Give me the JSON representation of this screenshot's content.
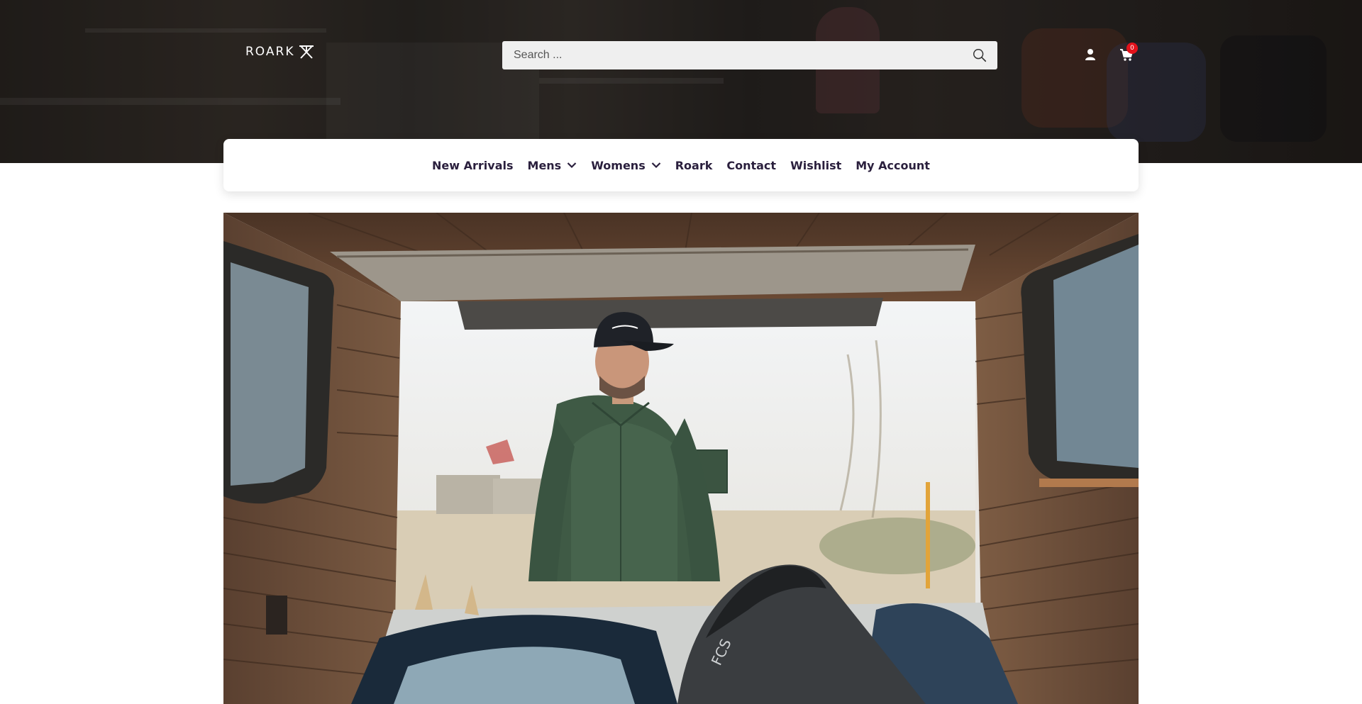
{
  "header": {
    "logo_text": "ROARK",
    "search": {
      "placeholder": "Search ...",
      "value": ""
    },
    "cart": {
      "count": "0"
    }
  },
  "nav": {
    "items": [
      {
        "label": "New Arrivals",
        "has_dropdown": false
      },
      {
        "label": "Mens",
        "has_dropdown": true
      },
      {
        "label": "Womens",
        "has_dropdown": true
      },
      {
        "label": "Roark",
        "has_dropdown": false
      },
      {
        "label": "Contact",
        "has_dropdown": false
      },
      {
        "label": "Wishlist",
        "has_dropdown": false
      },
      {
        "label": "My Account",
        "has_dropdown": false
      }
    ]
  },
  "icons": {
    "search": "search-icon",
    "user": "user-icon",
    "cart": "cart-icon",
    "dropdown": "chevron-down-icon",
    "logo_mark": "roark-logo-icon"
  },
  "colors": {
    "nav_text": "#2a1f3d",
    "badge": "#e3121b",
    "search_bg": "#efefef"
  }
}
